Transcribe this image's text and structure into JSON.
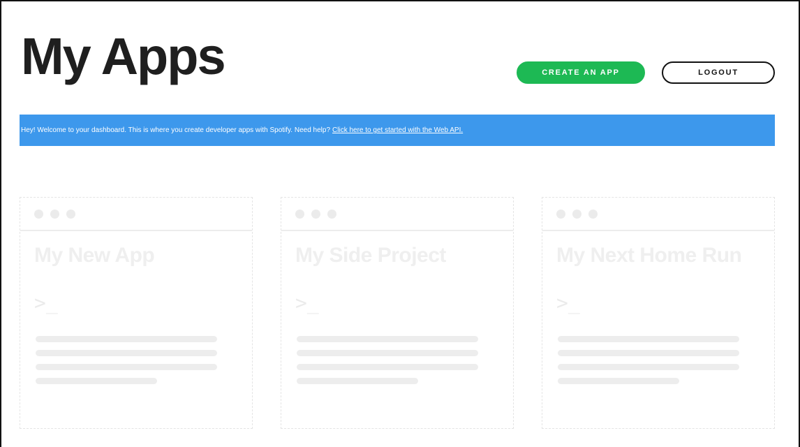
{
  "header": {
    "title": "My Apps",
    "create_button": "CREATE AN APP",
    "logout_button": "LOGOUT"
  },
  "banner": {
    "text": "Hey! Welcome to your dashboard. This is where you create developer apps with Spotify. Need help?",
    "link_text": "Click here to get started with the Web API."
  },
  "placeholder_cards": [
    {
      "title": "My New App",
      "prompt": ">_"
    },
    {
      "title": "My Side Project",
      "prompt": ">_"
    },
    {
      "title": "My Next Home Run",
      "prompt": ">_"
    }
  ],
  "colors": {
    "accent_green": "#1db954",
    "banner_blue": "#3d98ec",
    "text_dark": "#1f1f1f"
  }
}
